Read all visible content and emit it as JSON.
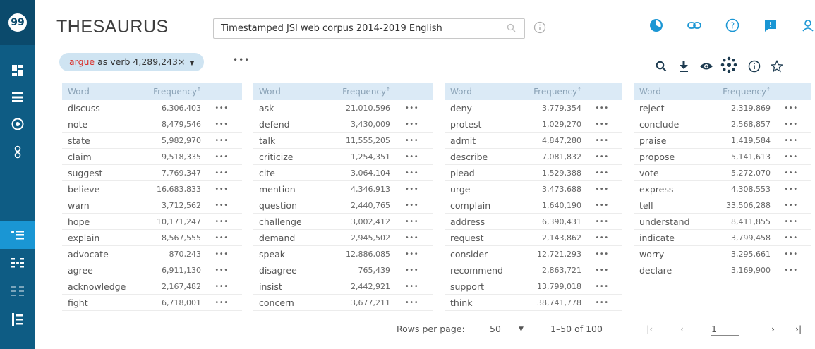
{
  "app": {
    "title": "THESAURUS",
    "corpus": "Timestamped JSI web corpus 2014-2019 English"
  },
  "query": {
    "lemma": "argue",
    "rest": " as verb 4,289,243×",
    "more": "•••"
  },
  "table_headers": {
    "word": "Word",
    "frequency": "Frequency",
    "sort_marker": "↑"
  },
  "row_more": "•••",
  "columns": [
    {
      "rows": [
        {
          "word": "discuss",
          "freq": "6,306,403"
        },
        {
          "word": "note",
          "freq": "8,479,546"
        },
        {
          "word": "state",
          "freq": "5,982,970"
        },
        {
          "word": "claim",
          "freq": "9,518,335"
        },
        {
          "word": "suggest",
          "freq": "7,769,347"
        },
        {
          "word": "believe",
          "freq": "16,683,833"
        },
        {
          "word": "warn",
          "freq": "3,712,562"
        },
        {
          "word": "hope",
          "freq": "10,171,247"
        },
        {
          "word": "explain",
          "freq": "8,567,555"
        },
        {
          "word": "advocate",
          "freq": "870,243"
        },
        {
          "word": "agree",
          "freq": "6,911,130"
        },
        {
          "word": "acknowledge",
          "freq": "2,167,482"
        },
        {
          "word": "fight",
          "freq": "6,718,001"
        }
      ]
    },
    {
      "rows": [
        {
          "word": "ask",
          "freq": "21,010,596"
        },
        {
          "word": "defend",
          "freq": "3,430,009"
        },
        {
          "word": "talk",
          "freq": "11,555,205"
        },
        {
          "word": "criticize",
          "freq": "1,254,351"
        },
        {
          "word": "cite",
          "freq": "3,064,104"
        },
        {
          "word": "mention",
          "freq": "4,346,913"
        },
        {
          "word": "question",
          "freq": "2,440,765"
        },
        {
          "word": "challenge",
          "freq": "3,002,412"
        },
        {
          "word": "demand",
          "freq": "2,945,502"
        },
        {
          "word": "speak",
          "freq": "12,886,085"
        },
        {
          "word": "disagree",
          "freq": "765,439"
        },
        {
          "word": "insist",
          "freq": "2,442,921"
        },
        {
          "word": "concern",
          "freq": "3,677,211"
        }
      ]
    },
    {
      "rows": [
        {
          "word": "deny",
          "freq": "3,779,354"
        },
        {
          "word": "protest",
          "freq": "1,029,270"
        },
        {
          "word": "admit",
          "freq": "4,847,280"
        },
        {
          "word": "describe",
          "freq": "7,081,832"
        },
        {
          "word": "plead",
          "freq": "1,529,388"
        },
        {
          "word": "urge",
          "freq": "3,473,688"
        },
        {
          "word": "complain",
          "freq": "1,640,190"
        },
        {
          "word": "address",
          "freq": "6,390,431"
        },
        {
          "word": "request",
          "freq": "2,143,862"
        },
        {
          "word": "consider",
          "freq": "12,721,293"
        },
        {
          "word": "recommend",
          "freq": "2,863,721"
        },
        {
          "word": "support",
          "freq": "13,799,018"
        },
        {
          "word": "think",
          "freq": "38,741,778"
        }
      ]
    },
    {
      "rows": [
        {
          "word": "reject",
          "freq": "2,319,869"
        },
        {
          "word": "conclude",
          "freq": "2,568,857"
        },
        {
          "word": "praise",
          "freq": "1,419,584"
        },
        {
          "word": "propose",
          "freq": "5,141,613"
        },
        {
          "word": "vote",
          "freq": "5,272,070"
        },
        {
          "word": "express",
          "freq": "4,308,553"
        },
        {
          "word": "tell",
          "freq": "33,506,288"
        },
        {
          "word": "understand",
          "freq": "8,411,855"
        },
        {
          "word": "indicate",
          "freq": "3,799,458"
        },
        {
          "word": "worry",
          "freq": "3,295,661"
        },
        {
          "word": "declare",
          "freq": "3,169,900"
        }
      ]
    }
  ],
  "pagination": {
    "rows_per_page_label": "Rows per page:",
    "rows_per_page_value": "50",
    "range": "1–50 of 100",
    "page": "1"
  },
  "colors": {
    "rail": "#0e5c84",
    "rail_active": "#1a96d4",
    "accent": "#1a96d4",
    "lemma": "#d9302b",
    "header_bg": "#dbeaf6"
  },
  "icons": {
    "rail": [
      "dashboard-icon",
      "list-icon",
      "target-icon",
      "pairs-icon",
      "thesaurus-icon",
      "compare-icon",
      "grid-icon",
      "ordered-list-icon"
    ],
    "top": [
      "feature-circle-icon",
      "link-icon",
      "help-icon",
      "feedback-icon",
      "user-icon"
    ],
    "tools": [
      "search-icon",
      "download-icon",
      "view-icon",
      "visualize-icon",
      "info-icon",
      "star-icon"
    ]
  }
}
